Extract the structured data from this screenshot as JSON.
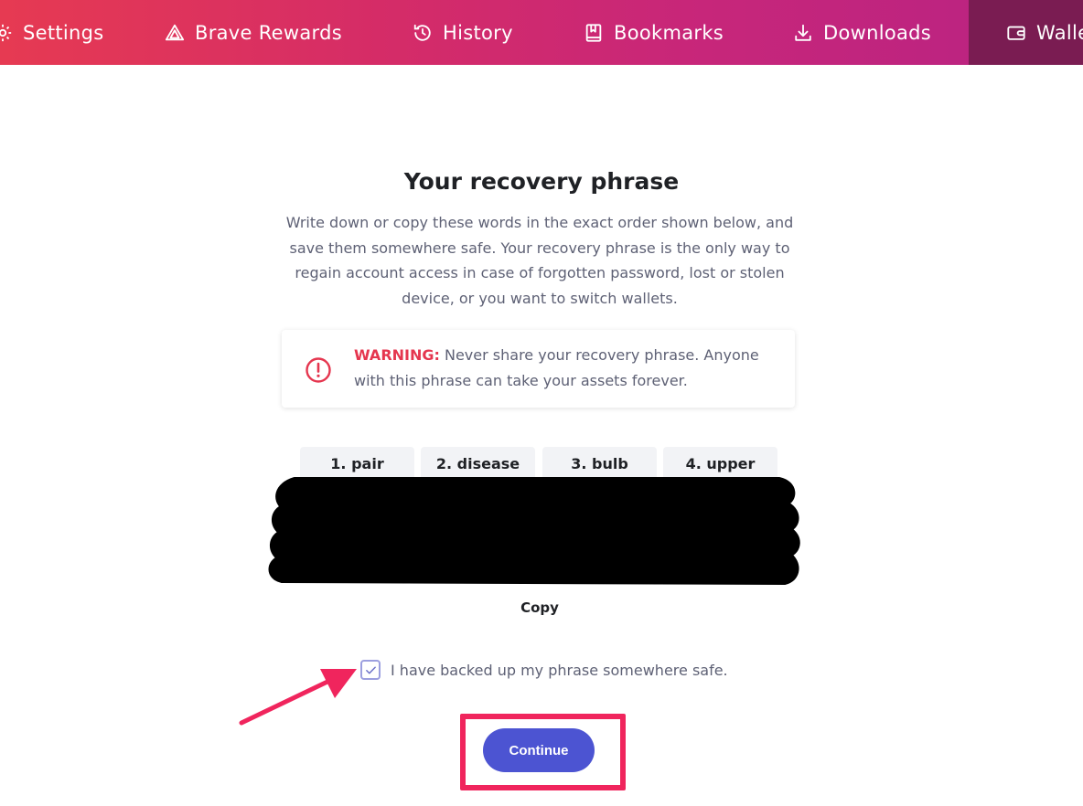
{
  "nav": {
    "items": [
      {
        "label": "Settings",
        "icon": "gear-icon"
      },
      {
        "label": "Brave Rewards",
        "icon": "brave-rewards-triangle-icon"
      },
      {
        "label": "History",
        "icon": "history-clock-icon"
      },
      {
        "label": "Bookmarks",
        "icon": "bookmark-book-icon"
      },
      {
        "label": "Downloads",
        "icon": "download-icon"
      },
      {
        "label": "Wallet",
        "icon": "wallet-icon"
      }
    ],
    "active_index": 5
  },
  "page": {
    "title": "Your recovery phrase",
    "description": "Write down or copy these words in the exact order shown below, and save them somewhere safe. Your recovery phrase is the only way to regain account access in case of forgotten password, lost or stolen device, or you want to switch wallets."
  },
  "warning": {
    "label": "WARNING:",
    "text": " Never share your recovery phrase. Anyone with this phrase can take your assets forever.",
    "icon": "warning-circle-icon"
  },
  "phrase": {
    "words": [
      "1. pair",
      "2. disease",
      "3. bulb",
      "4. upper"
    ],
    "remaining_hidden": true
  },
  "copy_label": "Copy",
  "backup_checkbox": {
    "checked": true,
    "label": "I have backed up my phrase somewhere safe."
  },
  "continue_label": "Continue",
  "colors": {
    "accent": "#4c54d2",
    "warning": "#e5364f",
    "annotation": "#f0255d",
    "nav_gradient_start": "#e63a52",
    "nav_gradient_end": "#b82383",
    "nav_active": "#7a1c52"
  }
}
